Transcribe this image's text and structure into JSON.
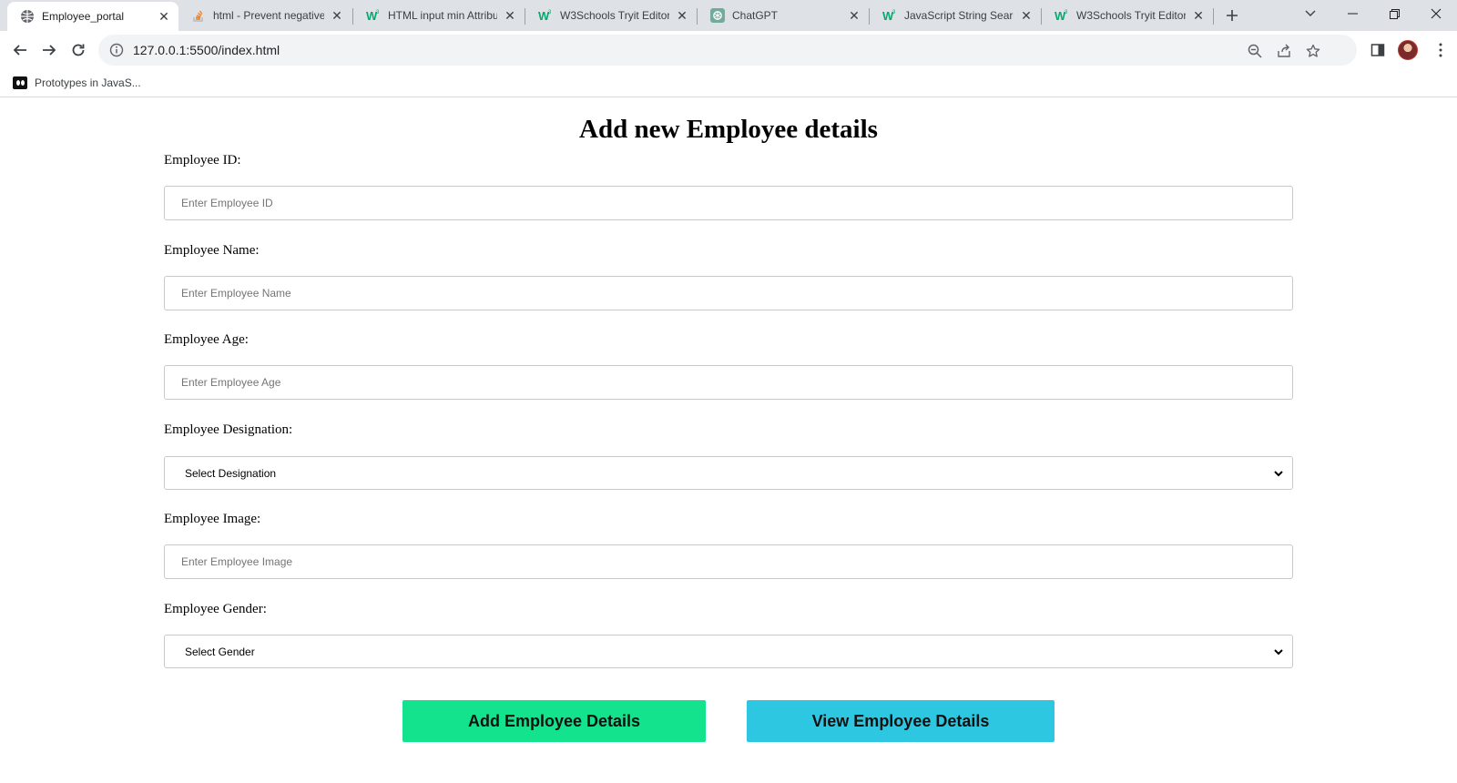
{
  "browser": {
    "tabs": [
      {
        "title": "Employee_portal",
        "favicon": "globe-icon",
        "active": true
      },
      {
        "title": "html - Prevent negative",
        "favicon": "stackoverflow-icon",
        "active": false
      },
      {
        "title": "HTML input min Attribu",
        "favicon": "w3schools-icon",
        "active": false
      },
      {
        "title": "W3Schools Tryit Editor",
        "favicon": "w3schools-icon",
        "active": false
      },
      {
        "title": "ChatGPT",
        "favicon": "chatgpt-icon",
        "active": false
      },
      {
        "title": "JavaScript String Search",
        "favicon": "w3schools-icon",
        "active": false
      },
      {
        "title": "W3Schools Tryit Editor",
        "favicon": "w3schools-icon",
        "active": false
      }
    ],
    "address": {
      "url": "127.0.0.1:5500/index.html"
    },
    "bookmarks": [
      {
        "label": "Prototypes in JavaS..."
      }
    ]
  },
  "page": {
    "title": "Add new Employee details",
    "fields": {
      "id": {
        "label": "Employee ID:",
        "placeholder": "Enter Employee ID"
      },
      "name": {
        "label": "Employee Name:",
        "placeholder": "Enter Employee Name"
      },
      "age": {
        "label": "Employee Age:",
        "placeholder": "Enter Employee Age"
      },
      "designation": {
        "label": "Employee Designation:",
        "selected": "Select Designation"
      },
      "image": {
        "label": "Employee Image:",
        "placeholder": "Enter Employee Image"
      },
      "gender": {
        "label": "Employee Gender:",
        "selected": "Select Gender"
      }
    },
    "buttons": {
      "add": "Add Employee Details",
      "view": "View Employee Details"
    },
    "colors": {
      "add_button": "#13e38d",
      "view_button": "#2ec7e2"
    }
  }
}
